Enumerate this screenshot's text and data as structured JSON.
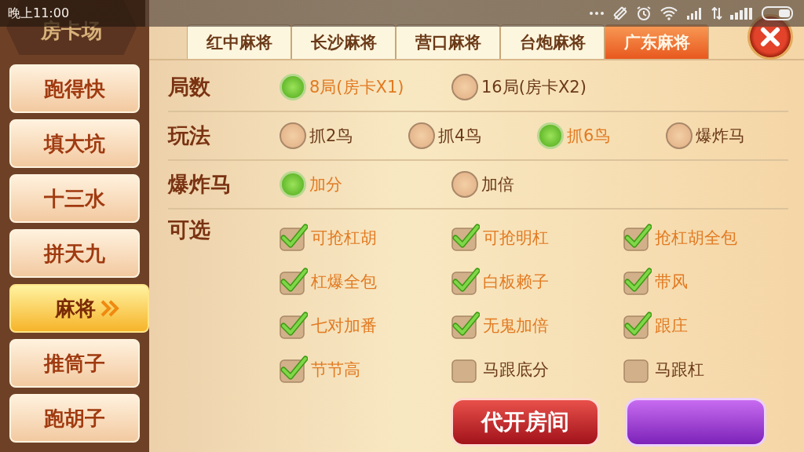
{
  "status_bar": {
    "time": "晚上11:00"
  },
  "header": {
    "title": "房卡场"
  },
  "sidebar": {
    "items": [
      {
        "label": "跑得快",
        "selected": false
      },
      {
        "label": "填大坑",
        "selected": false
      },
      {
        "label": "十三水",
        "selected": false
      },
      {
        "label": "拼天九",
        "selected": false
      },
      {
        "label": "麻将",
        "selected": true
      },
      {
        "label": "推筒子",
        "selected": false
      },
      {
        "label": "跑胡子",
        "selected": false
      }
    ]
  },
  "tabs": [
    {
      "label": "红中麻将",
      "selected": false
    },
    {
      "label": "长沙麻将",
      "selected": false
    },
    {
      "label": "营口麻将",
      "selected": false
    },
    {
      "label": "台炮麻将",
      "selected": false
    },
    {
      "label": "广东麻将",
      "selected": true
    }
  ],
  "settings": [
    {
      "label": "局数",
      "kind": "radio",
      "options": [
        {
          "label": "8局(房卡X1)",
          "selected": true
        },
        {
          "label": "16局(房卡X2)",
          "selected": false
        }
      ]
    },
    {
      "label": "玩法",
      "kind": "radio",
      "options": [
        {
          "label": "抓2鸟",
          "selected": false
        },
        {
          "label": "抓4鸟",
          "selected": false
        },
        {
          "label": "抓6鸟",
          "selected": true
        },
        {
          "label": "爆炸马",
          "selected": false
        }
      ]
    },
    {
      "label": "爆炸马",
      "kind": "radio",
      "options": [
        {
          "label": "加分",
          "selected": true
        },
        {
          "label": "加倍",
          "selected": false
        }
      ]
    },
    {
      "label": "可选",
      "kind": "checkbox",
      "options": [
        {
          "label": "可抢杠胡",
          "checked": true
        },
        {
          "label": "可抢明杠",
          "checked": true
        },
        {
          "label": "抢杠胡全包",
          "checked": true
        },
        {
          "label": "杠爆全包",
          "checked": true
        },
        {
          "label": "白板赖子",
          "checked": true
        },
        {
          "label": "带风",
          "checked": true
        },
        {
          "label": "七对加番",
          "checked": true
        },
        {
          "label": "无鬼加倍",
          "checked": true
        },
        {
          "label": "跟庄",
          "checked": true
        },
        {
          "label": "节节高",
          "checked": true
        },
        {
          "label": "马跟底分",
          "checked": false
        },
        {
          "label": "马跟杠",
          "checked": false
        }
      ]
    }
  ],
  "buttons": [
    {
      "label": "代开房间",
      "kind": "primary"
    },
    {
      "kind": "secondary"
    }
  ]
}
